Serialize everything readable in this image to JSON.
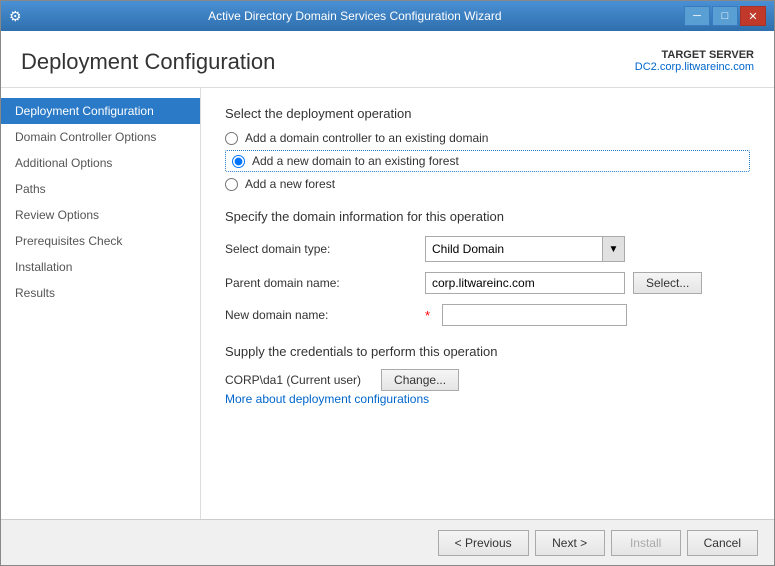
{
  "titleBar": {
    "icon": "⚙",
    "title": "Active Directory Domain Services Configuration Wizard",
    "minimize": "─",
    "maximize": "□",
    "close": "✕"
  },
  "header": {
    "pageTitle": "Deployment Configuration",
    "targetServerLabel": "TARGET SERVER",
    "targetServerName": "DC2.corp.litwareinc.com"
  },
  "sidebar": {
    "items": [
      {
        "label": "Deployment Configuration",
        "active": true
      },
      {
        "label": "Domain Controller Options",
        "active": false
      },
      {
        "label": "Additional Options",
        "active": false
      },
      {
        "label": "Paths",
        "active": false
      },
      {
        "label": "Review Options",
        "active": false
      },
      {
        "label": "Prerequisites Check",
        "active": false
      },
      {
        "label": "Installation",
        "active": false
      },
      {
        "label": "Results",
        "active": false
      }
    ]
  },
  "main": {
    "deploymentHeading": "Select the deployment operation",
    "radio1": "Add a domain controller to an existing domain",
    "radio2": "Add a new domain to an existing forest",
    "radio3": "Add a new forest",
    "domainInfoHeading": "Specify the domain information for this operation",
    "domainTypeLabel": "Select domain type:",
    "domainTypeValue": "Child Domain",
    "parentDomainLabel": "Parent domain name:",
    "parentDomainValue": "corp.litwareinc.com",
    "selectButtonLabel": "Select...",
    "newDomainLabel": "New domain name:",
    "newDomainValue": "",
    "newDomainRequired": "*",
    "credentialsHeading": "Supply the credentials to perform this operation",
    "credentialsUser": "CORP\\da1 (Current user)",
    "changeButtonLabel": "Change...",
    "moreLink": "More about deployment configurations"
  },
  "footer": {
    "previousLabel": "< Previous",
    "nextLabel": "Next >",
    "installLabel": "Install",
    "cancelLabel": "Cancel"
  }
}
